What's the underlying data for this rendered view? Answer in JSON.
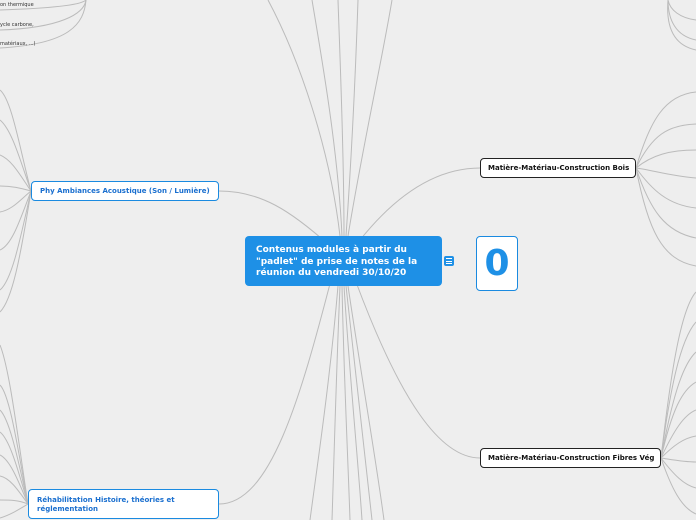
{
  "central_topic": {
    "line1": "Contenus modules à partir du",
    "line2": "\"padlet\" de prise de notes de la",
    "line3": "réunion du vendredi 30/10/20"
  },
  "topics": {
    "phy": "Phy Ambiances Acoustique (Son / Lumière)",
    "reha_line1": "Réhabilitation  Histoire, théories et",
    "reha_line2": "réglementation",
    "bois": "Matière-Matériau-Construction Bois",
    "fibres": "Matière-Matériau-Construction Fibres Vég"
  },
  "counter": "0",
  "fragments": {
    "f1": "on thermique",
    "f2": "ycle carbone,",
    "f3": "matériaux, ...)"
  },
  "icons": {
    "note": "note-icon"
  },
  "colors": {
    "background": "#eeeeee",
    "central": "#1e90e6",
    "blue_border": "#1a8ae0",
    "connector": "#bbbbbb"
  }
}
